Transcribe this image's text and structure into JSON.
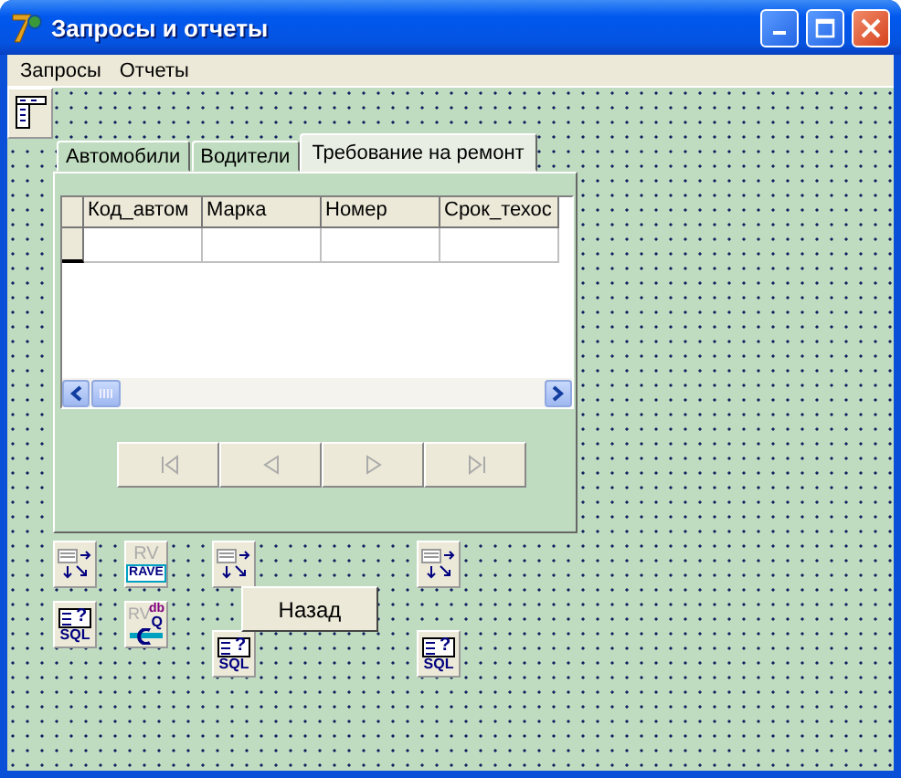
{
  "window": {
    "title": "Запросы и отчеты"
  },
  "menu": [
    {
      "label": "Запросы"
    },
    {
      "label": "Отчеты"
    }
  ],
  "tabs": [
    {
      "label": "Автомобили",
      "selected": false
    },
    {
      "label": "Водители",
      "selected": false
    },
    {
      "label": "Требование на ремонт",
      "selected": true
    }
  ],
  "grid": {
    "columns": [
      "Код_автом",
      "Марка",
      "Номер",
      "Срок_техос"
    ]
  },
  "navigator": [
    {
      "kind": "first",
      "disabled": true
    },
    {
      "kind": "prior",
      "disabled": true
    },
    {
      "kind": "next",
      "disabled": true
    },
    {
      "kind": "last",
      "disabled": true
    }
  ],
  "components": [
    {
      "kind": "datasource"
    },
    {
      "kind": "rave",
      "prefix": "RV",
      "label": "RAVE"
    },
    {
      "kind": "datasource"
    },
    {
      "kind": "datasource"
    },
    {
      "kind": "query",
      "symbol": "?",
      "label": "SQL"
    },
    {
      "kind": "rvquery",
      "prefix": "RV",
      "superscript": "db",
      "label": "Q"
    },
    {
      "kind": "query",
      "symbol": "?",
      "label": "SQL"
    },
    {
      "kind": "query",
      "symbol": "?",
      "label": "SQL"
    }
  ],
  "back_button": {
    "label": "Назад"
  }
}
